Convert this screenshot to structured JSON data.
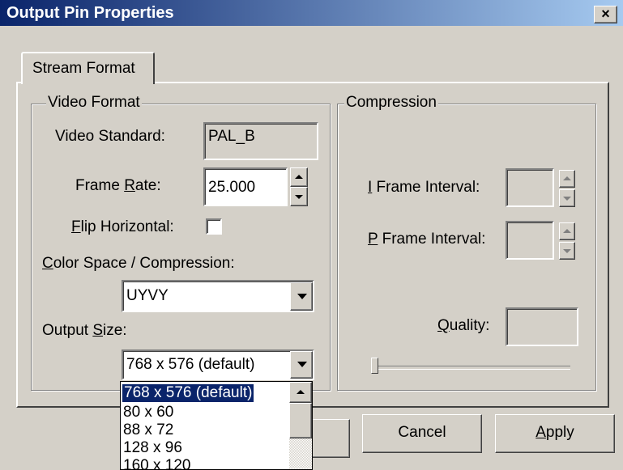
{
  "window": {
    "title": "Output Pin Properties",
    "close_glyph": "×"
  },
  "tabs": [
    {
      "label": "Stream Format",
      "active": true
    }
  ],
  "video_format": {
    "legend": "Video Format",
    "video_standard_label": "Video Standard:",
    "video_standard_value": "PAL_B",
    "frame_rate_label_pre": "Frame ",
    "frame_rate_label_key": "R",
    "frame_rate_label_post": "ate:",
    "frame_rate_value": "25.000",
    "flip_label_key": "F",
    "flip_label_post": "lip Horizontal:",
    "flip_checked": false,
    "color_space_label_key": "C",
    "color_space_label_post": "olor Space / Compression:",
    "color_space_value": "UYVY",
    "output_size_label_pre": "Output ",
    "output_size_label_key": "S",
    "output_size_label_post": "ize:",
    "output_size_value": "768 x 576  (default)",
    "output_size_options": [
      "768 x 576  (default)",
      "80 x 60",
      "88 x 72",
      "128 x 96",
      "160 x 120"
    ]
  },
  "compression": {
    "legend": "Compression",
    "i_frame_label_key": "I",
    "i_frame_label_post": " Frame Interval:",
    "p_frame_label_key": "P",
    "p_frame_label_post": " Frame Interval:",
    "quality_label_key": "Q",
    "quality_label_post": "uality:",
    "quality_slider_value": 0
  },
  "buttons": {
    "ok": "",
    "cancel": "Cancel",
    "apply_key": "A",
    "apply_post": "pply"
  }
}
